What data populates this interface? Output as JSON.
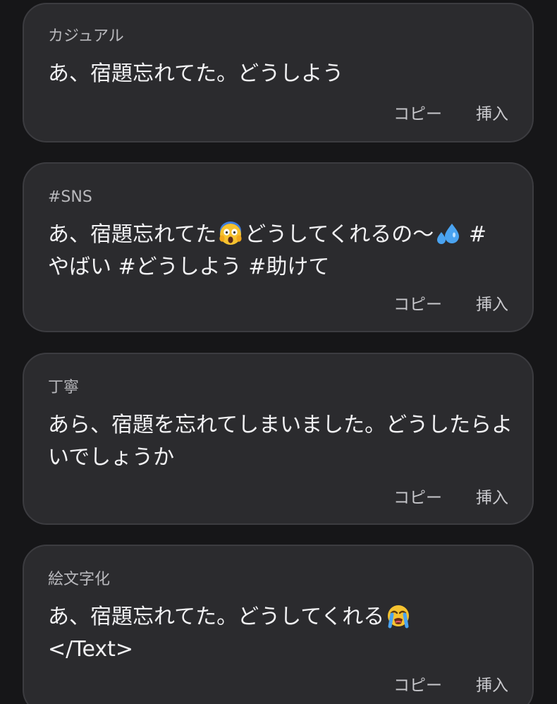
{
  "cards": [
    {
      "style": "カジュアル",
      "text": "あ、宿題忘れてた。どうしよう",
      "copy_label": "コピー",
      "insert_label": "挿入"
    },
    {
      "style": "#SNS",
      "text_part1": "あ、宿題忘れてた",
      "emoji1": "face-screaming-in-fear-emoji",
      "text_part2": "どうしてくれるの〜",
      "emoji2": "sweat-droplets-emoji",
      "text_part3": " # やばい #どうしよう #助けて",
      "copy_label": "コピー",
      "insert_label": "挿入"
    },
    {
      "style": "丁寧",
      "text": "あら、宿題を忘れてしまいました。どうしたらよいでしょうか",
      "copy_label": "コピー",
      "insert_label": "挿入"
    },
    {
      "style": "絵文字化",
      "text_part1": "あ、宿題忘れてた。どうしてくれる",
      "emoji1": "loudly-crying-face-emoji",
      "text_part2": "</Text>",
      "copy_label": "コピー",
      "insert_label": "挿入"
    }
  ],
  "colors": {
    "background": "#161618",
    "card": "#2b2b2e",
    "card_border": "#3c3c40",
    "text": "#f2f2f4",
    "label": "#b9b9bd"
  }
}
